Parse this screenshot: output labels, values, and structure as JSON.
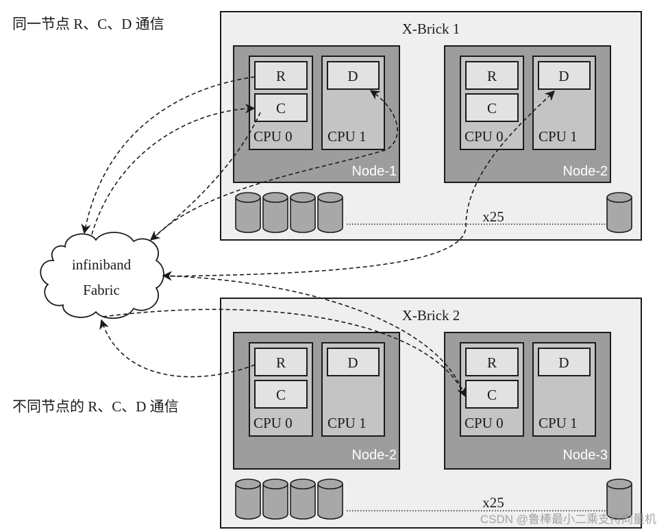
{
  "captions": {
    "same_node": "同一节点 R、C、D 通信",
    "diff_node": "不同节点的 R、C、D 通信"
  },
  "fabric": {
    "line1": "infiniband",
    "line2": "Fabric"
  },
  "bricks": [
    {
      "title": "X-Brick 1",
      "disk_count_label": "x25",
      "nodes": [
        {
          "label": "Node-1",
          "cpu0": "CPU 0",
          "cpu1": "CPU 1",
          "r": "R",
          "c": "C",
          "d": "D"
        },
        {
          "label": "Node-2",
          "cpu0": "CPU 0",
          "cpu1": "CPU 1",
          "r": "R",
          "c": "C",
          "d": "D"
        }
      ]
    },
    {
      "title": "X-Brick 2",
      "disk_count_label": "x25",
      "nodes": [
        {
          "label": "Node-2",
          "cpu0": "CPU 0",
          "cpu1": "CPU 1",
          "r": "R",
          "c": "C",
          "d": "D"
        },
        {
          "label": "Node-3",
          "cpu0": "CPU 0",
          "cpu1": "CPU 1",
          "r": "R",
          "c": "C",
          "d": "D"
        }
      ]
    }
  ],
  "watermark": "CSDN @鲁棒最小二乘支持向量机",
  "colors": {
    "brick": "#efefef",
    "node": "#9d9d9d",
    "cpu": "#c4c4c4",
    "unit": "#e2e2e2",
    "disk": "#a8a8a8"
  }
}
